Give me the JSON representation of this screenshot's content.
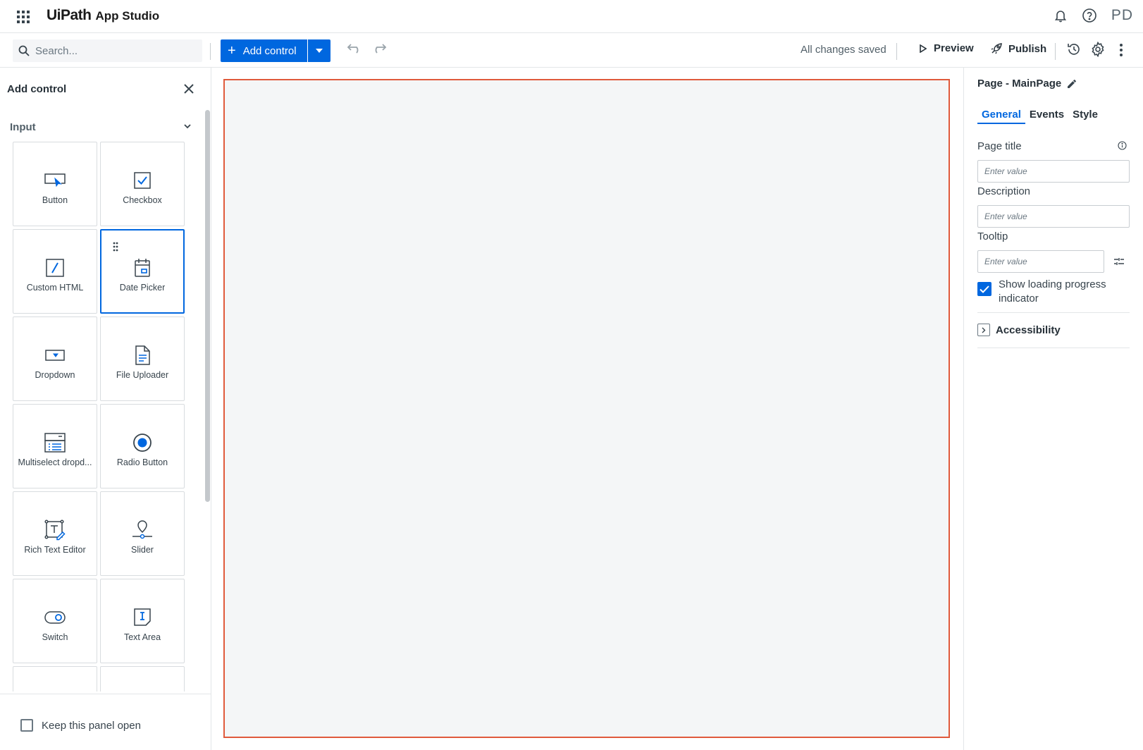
{
  "app": {
    "brand": "UiPath",
    "product": "App Studio",
    "avatar_initials": "PD"
  },
  "toolbar": {
    "search_placeholder": "Search...",
    "add_control_label": "Add control",
    "save_status": "All changes saved",
    "preview_label": "Preview",
    "publish_label": "Publish"
  },
  "left_panel": {
    "title": "Add control",
    "section": "Input",
    "controls": [
      {
        "label": "Button",
        "icon": "button-icon"
      },
      {
        "label": "Checkbox",
        "icon": "checkbox-icon"
      },
      {
        "label": "Custom HTML",
        "icon": "custom-html-icon"
      },
      {
        "label": "Date Picker",
        "icon": "date-picker-icon"
      },
      {
        "label": "Dropdown",
        "icon": "dropdown-icon"
      },
      {
        "label": "File Uploader",
        "icon": "file-uploader-icon"
      },
      {
        "label": "Multiselect dropd...",
        "icon": "multiselect-dropdown-icon"
      },
      {
        "label": "Radio Button",
        "icon": "radio-button-icon"
      },
      {
        "label": "Rich Text Editor",
        "icon": "rich-text-editor-icon"
      },
      {
        "label": "Slider",
        "icon": "slider-icon"
      },
      {
        "label": "Switch",
        "icon": "switch-icon"
      },
      {
        "label": "Text Area",
        "icon": "text-area-icon"
      }
    ],
    "keep_open_label": "Keep this panel open"
  },
  "right_panel": {
    "title": "Page - MainPage",
    "tabs": [
      "General",
      "Events",
      "Style"
    ],
    "active_tab": "General",
    "fields": {
      "page_title_label": "Page title",
      "description_label": "Description",
      "tooltip_label": "Tooltip",
      "placeholder": "Enter value"
    },
    "loading_indicator_label": "Show loading progress indicator",
    "loading_indicator_checked": true,
    "accessibility_label": "Accessibility"
  },
  "colors": {
    "accent": "#0067df",
    "canvas_border": "#e05a3c",
    "canvas_bg": "#f4f6f7"
  }
}
